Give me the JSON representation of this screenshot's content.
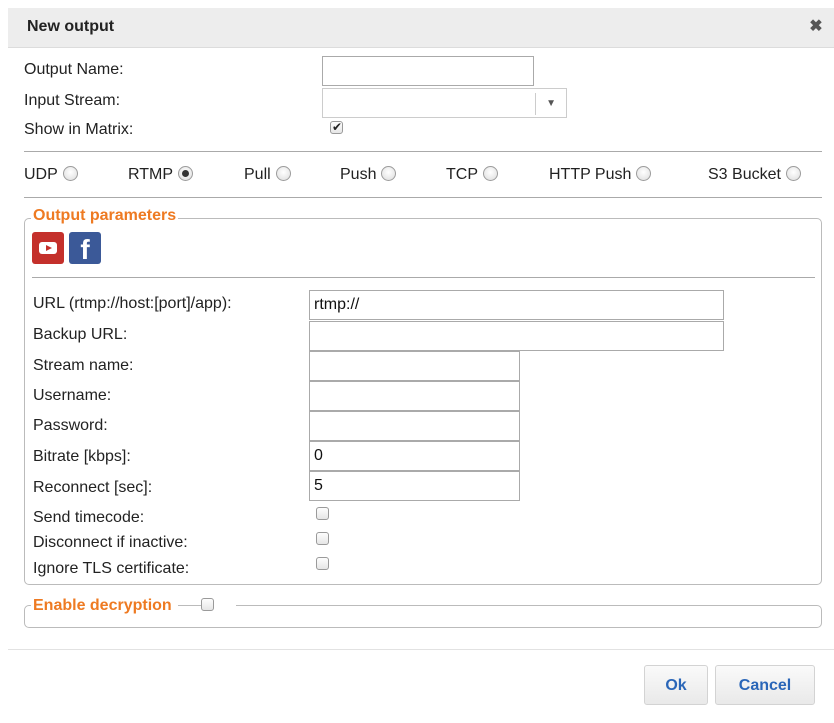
{
  "dialog": {
    "title": "New output",
    "close_glyph": "✖"
  },
  "general": {
    "output_name_label": "Output Name:",
    "output_name_value": "",
    "input_stream_label": "Input Stream:",
    "input_stream_value": "",
    "show_in_matrix_label": "Show in Matrix:",
    "show_in_matrix_checked": true
  },
  "output_types": {
    "selected": "RTMP",
    "items": [
      "UDP",
      "RTMP",
      "Pull",
      "Push",
      "TCP",
      "HTTP Push",
      "S3 Bucket"
    ]
  },
  "output_parameters": {
    "legend": "Output parameters",
    "presets": [
      "youtube-icon",
      "facebook-icon"
    ],
    "fb_glyph": "f",
    "url_label": "URL (rtmp://host:[port]/app):",
    "url_value": "rtmp://",
    "backup_url_label": "Backup URL:",
    "backup_url_value": "",
    "stream_name_label": "Stream name:",
    "stream_name_value": "",
    "username_label": "Username:",
    "username_value": "",
    "password_label": "Password:",
    "password_value": "",
    "bitrate_label": "Bitrate [kbps]:",
    "bitrate_value": "0",
    "reconnect_label": "Reconnect [sec]:",
    "reconnect_value": "5",
    "send_timecode_label": "Send timecode:",
    "send_timecode_checked": false,
    "disconnect_label": "Disconnect if inactive:",
    "disconnect_checked": false,
    "ignore_tls_label": "Ignore TLS certificate:",
    "ignore_tls_checked": false
  },
  "decryption": {
    "legend": "Enable decryption",
    "checked": false
  },
  "buttons": {
    "ok": "Ok",
    "cancel": "Cancel"
  },
  "colors": {
    "accent_orange": "#ee7a22",
    "button_text_blue": "#2a66b8",
    "youtube_red": "#c4302b",
    "facebook_blue": "#3b5998"
  }
}
